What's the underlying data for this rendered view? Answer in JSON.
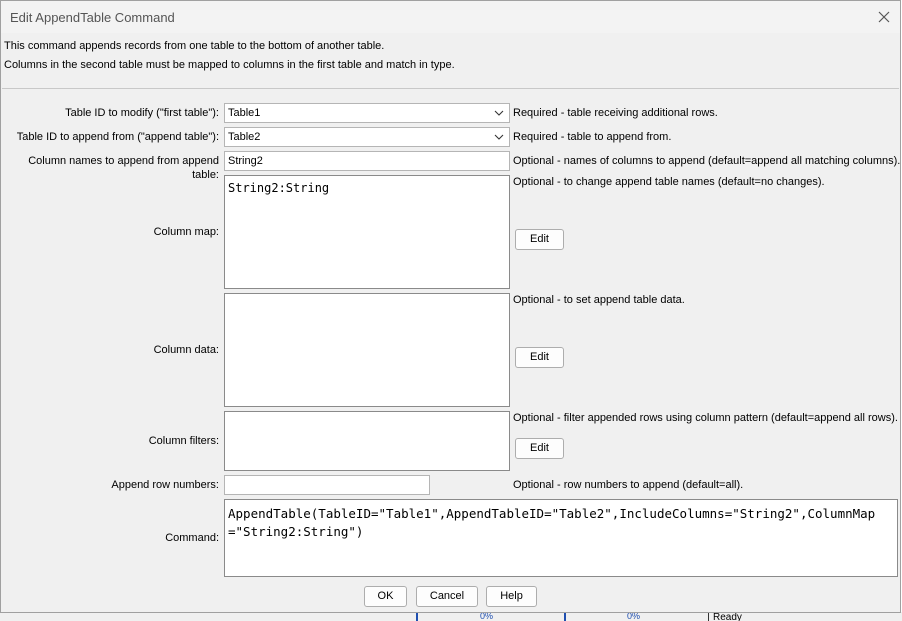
{
  "window": {
    "title": "Edit AppendTable Command"
  },
  "description": {
    "line1": "This command appends records from one table to the bottom of another table.",
    "line2": "Columns in the second table must be mapped to columns in the first table and match in type."
  },
  "form": {
    "table_id": {
      "label": "Table ID to modify (\"first table\"):",
      "value": "Table1",
      "hint": "Required - table receiving additional rows."
    },
    "append_table_id": {
      "label": "Table ID to append from (\"append table\"):",
      "value": "Table2",
      "hint": "Required - table to append from."
    },
    "include_columns": {
      "label": "Column names to append from append table:",
      "value": "String2",
      "hint": "Optional - names of columns to append (default=append all matching columns)."
    },
    "column_map": {
      "label": "Column map:",
      "value": "String2:String",
      "hint": "Optional - to change append table names (default=no changes).",
      "edit_label": "Edit"
    },
    "column_data": {
      "label": "Column data:",
      "value": "",
      "hint": "Optional - to set append table data.",
      "edit_label": "Edit"
    },
    "column_filters": {
      "label": "Column filters:",
      "value": "",
      "hint": "Optional - filter appended rows using column pattern (default=append all rows).",
      "edit_label": "Edit"
    },
    "append_rows": {
      "label": "Append row numbers:",
      "value": "",
      "hint": "Optional - row numbers to append (default=all)."
    },
    "command": {
      "label": "Command:",
      "value": "AppendTable(TableID=\"Table1\",AppendTableID=\"Table2\",IncludeColumns=\"String2\",ColumnMap=\"String2:String\")"
    }
  },
  "buttons": {
    "ok": "OK",
    "cancel": "Cancel",
    "help": "Help"
  },
  "background": {
    "pct1": "0%",
    "pct2": "0%",
    "status": "Ready"
  }
}
